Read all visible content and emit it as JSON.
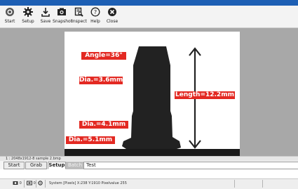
{
  "toolbar": {
    "buttons": [
      {
        "label": "Start",
        "icon": "start-icon"
      },
      {
        "label": "Setup",
        "icon": "gear-icon"
      },
      {
        "label": "Save",
        "icon": "save-icon"
      },
      {
        "label": "Snapshot",
        "icon": "camera-icon"
      },
      {
        "label": "Inspect",
        "icon": "inspect-icon"
      },
      {
        "label": "Help",
        "icon": "help-icon"
      },
      {
        "label": "Close",
        "icon": "close-icon"
      }
    ]
  },
  "image": {
    "annotations": {
      "angle": "Angle=36°",
      "dia_top": "Dia.=3.6mm",
      "length": "Length=12.2mm",
      "dia_mid": "Dia.=4.1mm",
      "dia_bottom": "Dia.=5.1mm"
    },
    "colors": {
      "label_bg": "#e32922",
      "part": "#222222"
    }
  },
  "image_info": "1 : 2048x1912-8 sample 2.bmp",
  "tabs": {
    "start": "Start",
    "grab": "Grab",
    "setup": "Setup",
    "batch": "Batch",
    "test": "Test"
  },
  "status": {
    "zoom_icon": "zoom-icon",
    "zoom_value": "0",
    "view_icon": "view-icon",
    "view_value": "0",
    "settings_icon": "settings-icon",
    "text": "System [Pixels] X:238 Y:1910 Pixelvalue 255"
  }
}
